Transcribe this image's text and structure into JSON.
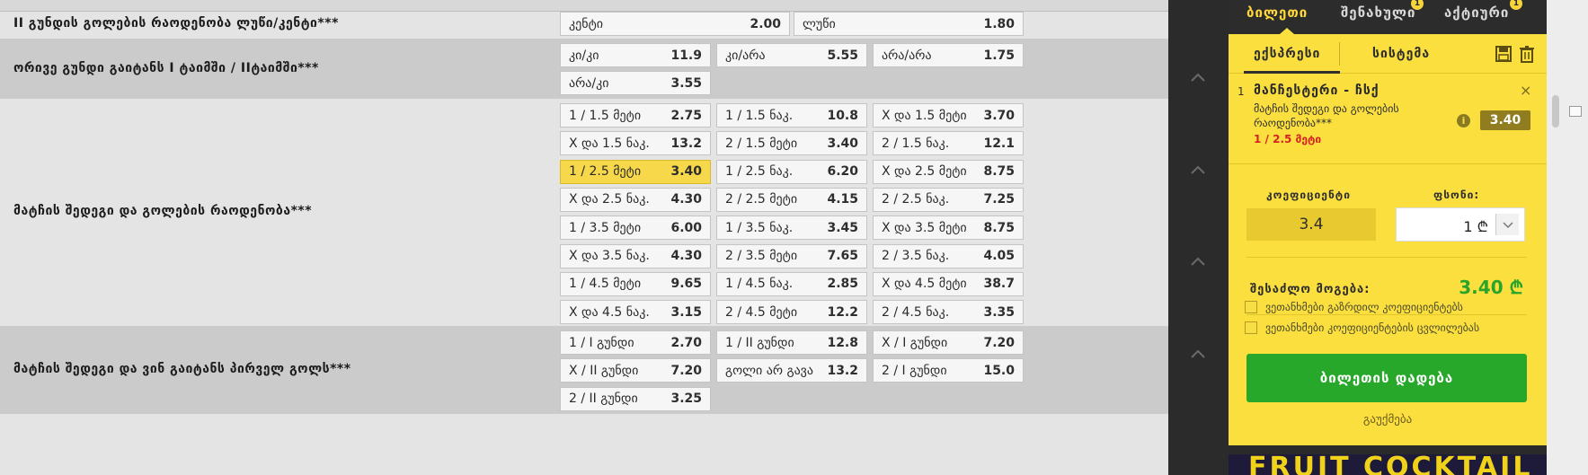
{
  "markets": [
    {
      "title": "II გუნდის გოლების რაოდენობა ლუწი/კენტი***",
      "odds": [
        {
          "label": "კენტი",
          "value": "2.00"
        },
        {
          "label": "ლუწი",
          "value": "1.80"
        }
      ]
    },
    {
      "title": "ორივე გუნდი გაიტანს I ტაიმში / IIტაიმში***",
      "odds": [
        {
          "label": "კი/კი",
          "value": "11.9"
        },
        {
          "label": "კი/არა",
          "value": "5.55"
        },
        {
          "label": "არა/არა",
          "value": "1.75"
        },
        {
          "label": "არა/კი",
          "value": "3.55"
        }
      ]
    },
    {
      "title": "მატჩის შედეგი და გოლების რაოდენობა***",
      "odds": [
        {
          "label": "1 / 1.5 მეტი",
          "value": "2.75"
        },
        {
          "label": "1 / 1.5 ნაკ.",
          "value": "10.8"
        },
        {
          "label": "X და 1.5 მეტი",
          "value": "3.70"
        },
        {
          "label": "X და 1.5 ნაკ.",
          "value": "13.2"
        },
        {
          "label": "2 / 1.5 მეტი",
          "value": "3.40"
        },
        {
          "label": "2 / 1.5 ნაკ.",
          "value": "12.1"
        },
        {
          "label": "1 / 2.5 მეტი",
          "value": "3.40",
          "selected": true
        },
        {
          "label": "1 / 2.5 ნაკ.",
          "value": "6.20"
        },
        {
          "label": "X და 2.5 მეტი",
          "value": "8.75"
        },
        {
          "label": "X და 2.5 ნაკ.",
          "value": "4.30"
        },
        {
          "label": "2 / 2.5 მეტი",
          "value": "4.15"
        },
        {
          "label": "2 / 2.5 ნაკ.",
          "value": "7.25"
        },
        {
          "label": "1 / 3.5 მეტი",
          "value": "6.00"
        },
        {
          "label": "1 / 3.5 ნაკ.",
          "value": "3.45"
        },
        {
          "label": "X და 3.5 მეტი",
          "value": "8.75"
        },
        {
          "label": "X და 3.5 ნაკ.",
          "value": "4.30"
        },
        {
          "label": "2 / 3.5 მეტი",
          "value": "7.65"
        },
        {
          "label": "2 / 3.5 ნაკ.",
          "value": "4.05"
        },
        {
          "label": "1 / 4.5 მეტი",
          "value": "9.65"
        },
        {
          "label": "1 / 4.5 ნაკ.",
          "value": "2.85"
        },
        {
          "label": "X და 4.5 მეტი",
          "value": "38.7"
        },
        {
          "label": "X და 4.5 ნაკ.",
          "value": "3.15"
        },
        {
          "label": "2 / 4.5 მეტი",
          "value": "12.2"
        },
        {
          "label": "2 / 4.5 ნაკ.",
          "value": "3.35"
        }
      ]
    },
    {
      "title": "მატჩის შედეგი და ვინ გაიტანს პირველ გოლს***",
      "odds": [
        {
          "label": "1 / I გუნდი",
          "value": "2.70"
        },
        {
          "label": "1 / II გუნდი",
          "value": "12.8"
        },
        {
          "label": "X / I გუნდი",
          "value": "7.20"
        },
        {
          "label": "X / II გუნდი",
          "value": "7.20"
        },
        {
          "label": "გოლი არ გავა",
          "value": "13.2"
        },
        {
          "label": "2 / I გუნდი",
          "value": "15.0"
        },
        {
          "label": "2 / II გუნდი",
          "value": "3.25"
        }
      ]
    }
  ],
  "betslip": {
    "tabs": [
      {
        "label": "ბილეთი",
        "badge": null,
        "active": true
      },
      {
        "label": "შენახული",
        "badge": "1",
        "active": false
      },
      {
        "label": "აქტიური",
        "badge": "1",
        "active": false
      }
    ],
    "modes": {
      "express": "ექსპრესი",
      "system": "სისტემა"
    },
    "bet": {
      "index": "1",
      "match": "მანჩესტერი - ჩსქ",
      "market": "მატჩის შედეგი და გოლების რაოდენობა***",
      "selection": "1 / 2.5 მეტი",
      "odd": "3.40",
      "info_icon": "i",
      "close_icon": "×"
    },
    "coef_label": "კოეფიციენტი",
    "coef_value": "3.4",
    "stake_label": "ფსონი:",
    "stake_value": "1 ₾",
    "win_label": "შესაძლო მოგება:",
    "win_value": "3.40 ₾",
    "checkbox_1": "ვეთანხმები გაზრდილ კოეფიციენტებს",
    "checkbox_2": "ვეთანხმები კოეფიციენტების ცვლილებას",
    "place_button": "ბილეთის დადება",
    "cancel_link": "გაუქმება",
    "promo_text": "FRUIT COCKTAIL"
  },
  "colors": {
    "betslip_bg": "#fbdf3f",
    "selected_odd": "#f7d84a",
    "place_button": "#27a82b",
    "win_value": "#2aa52a",
    "selection_text": "#d52121"
  }
}
